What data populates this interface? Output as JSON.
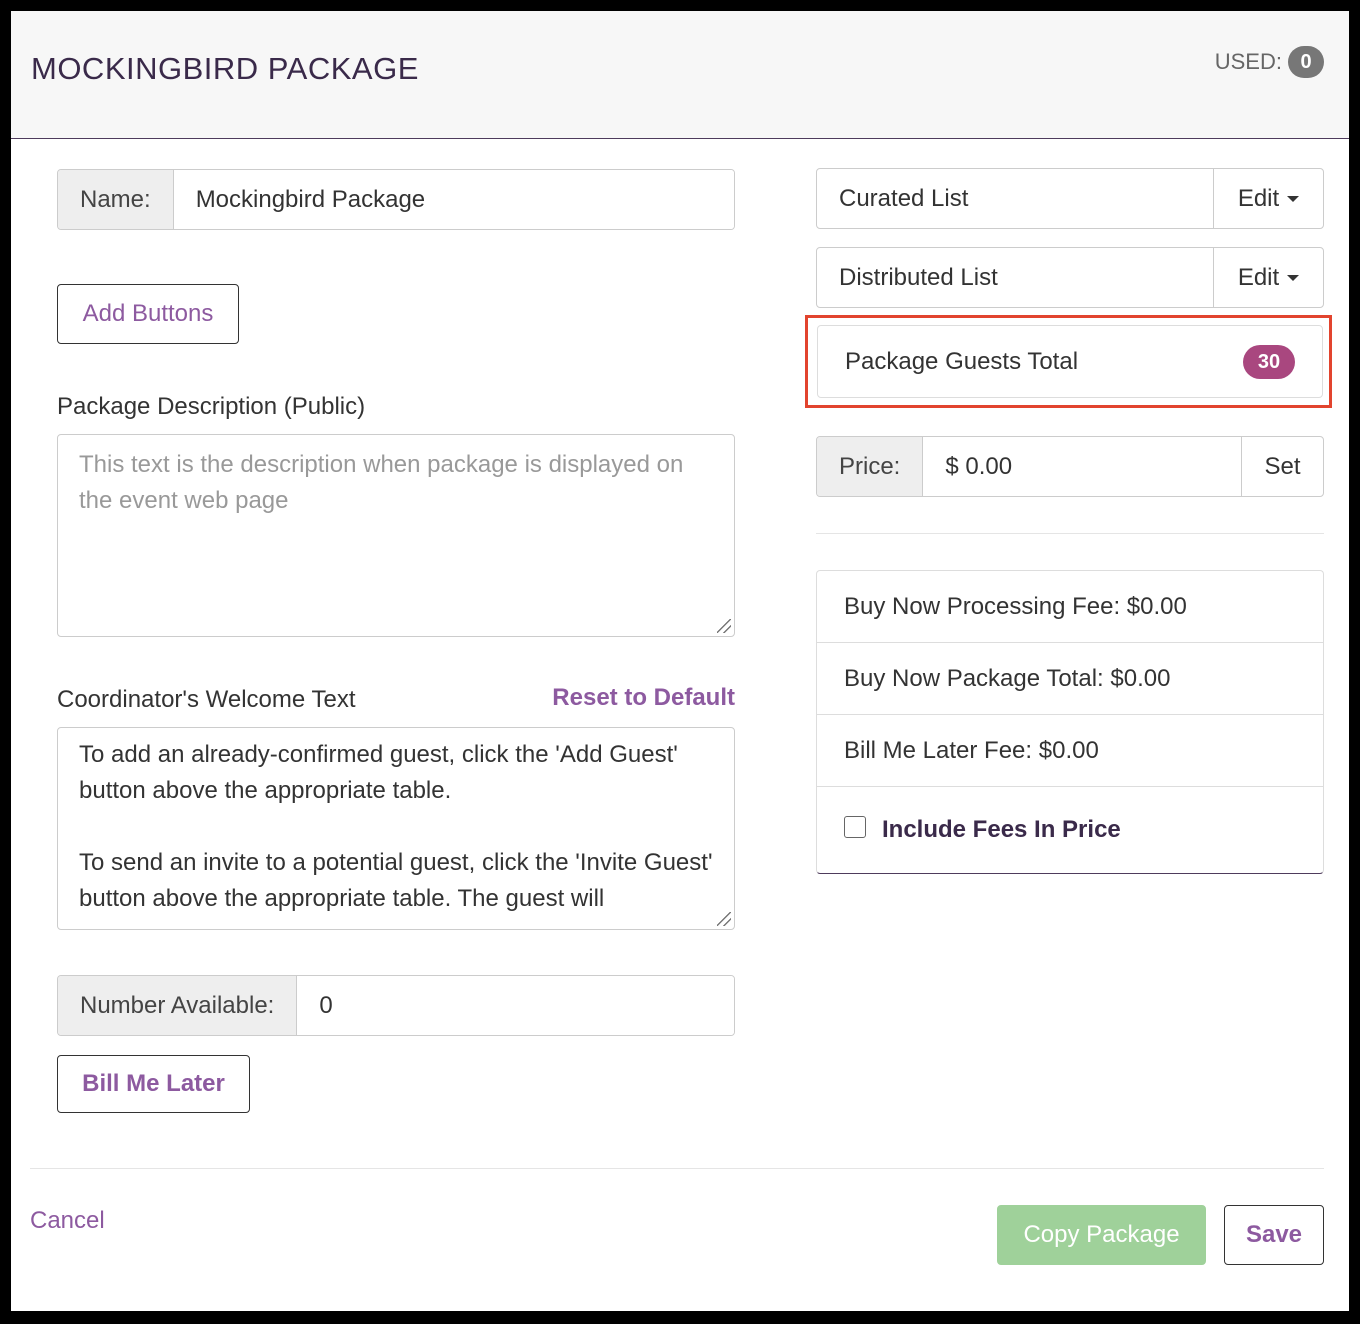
{
  "header": {
    "title": "MOCKINGBIRD PACKAGE",
    "used_label": "USED:",
    "used_count": "0"
  },
  "name_field": {
    "label": "Name:",
    "value": "Mockingbird Package"
  },
  "add_buttons_label": "Add Buttons",
  "description": {
    "label": "Package Description (Public)",
    "placeholder": "This text is the description when package is displayed on the event web page"
  },
  "welcome": {
    "label": "Coordinator's Welcome Text",
    "reset_label": "Reset to Default",
    "paragraph1": "To add an already-confirmed guest, click the 'Add Guest' button above the appropriate table.",
    "paragraph2": "To send an invite to a potential guest, click the 'Invite Guest' button above the appropriate table. The guest will"
  },
  "number_available": {
    "label": "Number Available:",
    "value": "0"
  },
  "bill_me_later_label": "Bill Me Later",
  "lists": [
    {
      "name": "Curated List",
      "edit_label": "Edit"
    },
    {
      "name": "Distributed List",
      "edit_label": "Edit"
    }
  ],
  "guests_total": {
    "label": "Package Guests Total",
    "count": "30"
  },
  "price": {
    "label": "Price:",
    "value": "$ 0.00",
    "set_label": "Set"
  },
  "fees": {
    "processing": "Buy Now Processing Fee: $0.00",
    "package_total": "Buy Now Package Total: $0.00",
    "bill_later_fee": "Bill Me Later Fee: $0.00",
    "include_label": "Include Fees In Price"
  },
  "footer": {
    "cancel_label": "Cancel",
    "copy_label": "Copy Package",
    "save_label": "Save"
  },
  "colors": {
    "accent": "#8d5aa0",
    "badge": "#a9477f",
    "copy_button": "#9fd19a",
    "highlight": "#e2442e"
  }
}
